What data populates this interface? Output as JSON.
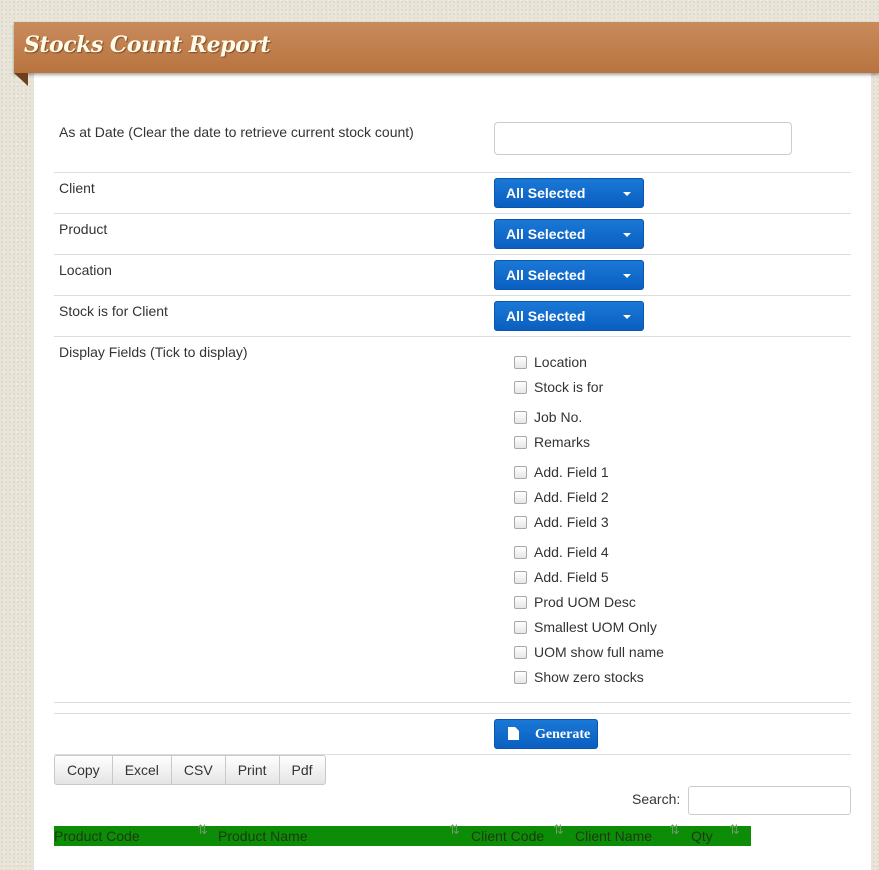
{
  "header": {
    "title": "Stocks Count Report"
  },
  "form": {
    "as_at_date": {
      "label": "As at Date (Clear the date to retrieve current stock count)",
      "value": "",
      "placeholder": ""
    },
    "client": {
      "label": "Client",
      "selected": "All Selected"
    },
    "product": {
      "label": "Product",
      "selected": "All Selected"
    },
    "location": {
      "label": "Location",
      "selected": "All Selected"
    },
    "stock_for_client": {
      "label": "Stock is for Client",
      "selected": "All Selected"
    },
    "display_fields": {
      "label": "Display Fields (Tick to display)",
      "options": [
        {
          "label": "Location",
          "checked": false
        },
        {
          "label": "Stock is for",
          "checked": false
        },
        {
          "label": "Job No.",
          "checked": false
        },
        {
          "label": "Remarks",
          "checked": false
        },
        {
          "label": "Add. Field 1",
          "checked": false
        },
        {
          "label": "Add. Field 2",
          "checked": false
        },
        {
          "label": "Add. Field 3",
          "checked": false
        },
        {
          "label": "Add. Field 4",
          "checked": false
        },
        {
          "label": "Add. Field 5",
          "checked": false
        },
        {
          "label": "Prod UOM Desc",
          "checked": false
        },
        {
          "label": "Smallest UOM Only",
          "checked": false
        },
        {
          "label": "UOM show full name",
          "checked": false
        },
        {
          "label": "Show zero stocks",
          "checked": false
        }
      ]
    },
    "generate_label": "Generate"
  },
  "table_tools": {
    "buttons": [
      "Copy",
      "Excel",
      "CSV",
      "Print",
      "Pdf"
    ],
    "search_label": "Search:",
    "search_value": ""
  },
  "table": {
    "header_color": "#0d8c08",
    "columns": [
      "Product Code",
      "Product Name",
      "Client Code",
      "Client Name",
      "Qty"
    ]
  },
  "colors": {
    "brand_header": "#b8743f",
    "primary_button": "#0a5fc0"
  }
}
